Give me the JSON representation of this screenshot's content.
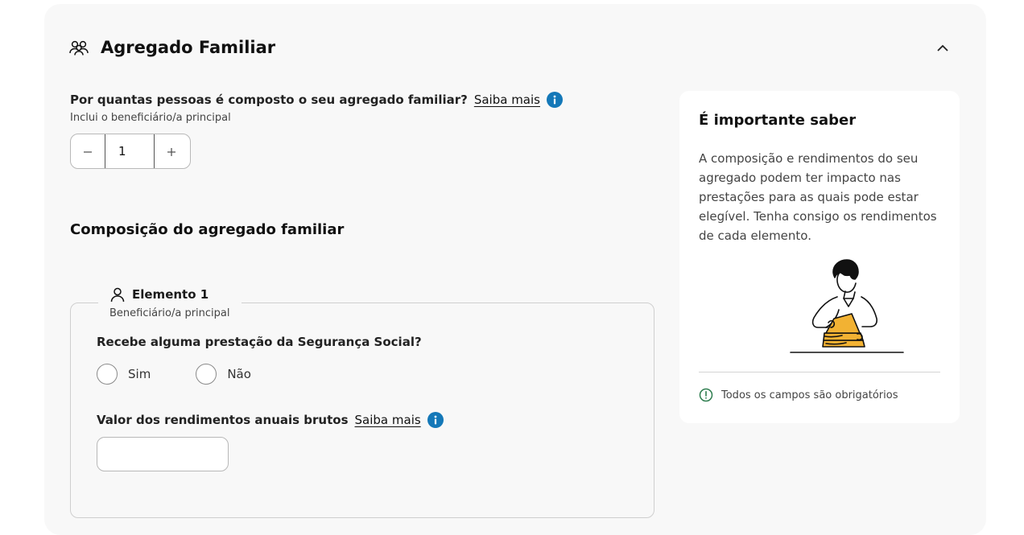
{
  "section": {
    "title": "Agregado Familiar",
    "icon": "people-icon",
    "collapse_icon": "chevron-up-icon"
  },
  "household": {
    "question": "Por quantas pessoas é composto o seu agregado familiar?",
    "link": "Saiba mais",
    "hint": "Inclui o beneficiário/a principal",
    "stepper": {
      "value": "1",
      "decrement_icon": "minus-icon",
      "increment_icon": "plus-icon"
    }
  },
  "composition": {
    "heading": "Composição do agregado familiar",
    "element": {
      "title": "Elemento 1",
      "subtitle": "Beneficiário/a principal",
      "benefit_question": "Recebe alguma prestação da Segurança Social?",
      "options": [
        "Sim",
        "Não"
      ],
      "income_label": "Valor dos rendimentos anuais brutos",
      "income_link": "Saiba mais",
      "income_value": ""
    }
  },
  "aside": {
    "title": "É importante saber",
    "text": "A composição e rendimentos do seu agregado podem ter impacto nas prestações para as quais pode estar elegível. Tenha consigo os rendimentos de cada elemento.",
    "footnote": "Todos os campos são obrigatórios"
  },
  "colors": {
    "accent": "#1478b8",
    "panel": "#f8f8f8",
    "success": "#2e7d4f",
    "illustration": "#f2b233"
  }
}
